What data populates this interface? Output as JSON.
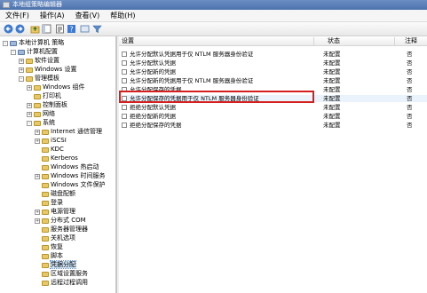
{
  "window": {
    "title": "本地组策略编辑器"
  },
  "menu": [
    "文件(F)",
    "操作(A)",
    "查看(V)",
    "帮助(H)"
  ],
  "toolbar": [
    "back-arrow-icon",
    "forward-arrow-icon",
    "up-folder-icon",
    "show-hide-tree-icon",
    "properties-icon",
    "help-icon",
    "view-icon",
    "filter-icon"
  ],
  "tree": [
    {
      "label": "本地计算机 策略",
      "level": 0,
      "expand": "-",
      "icon": "comp"
    },
    {
      "label": "计算机配置",
      "level": 1,
      "expand": "-",
      "icon": "comp"
    },
    {
      "label": "软件设置",
      "level": 2,
      "expand": "+",
      "icon": "folder"
    },
    {
      "label": "Windows 设置",
      "level": 2,
      "expand": "+",
      "icon": "folder"
    },
    {
      "label": "管理模板",
      "level": 2,
      "expand": "-",
      "icon": "folder"
    },
    {
      "label": "Windows 组件",
      "level": 3,
      "expand": "+",
      "icon": "folder"
    },
    {
      "label": "打印机",
      "level": 3,
      "expand": "",
      "icon": "folder"
    },
    {
      "label": "控制面板",
      "level": 3,
      "expand": "+",
      "icon": "folder"
    },
    {
      "label": "网络",
      "level": 3,
      "expand": "+",
      "icon": "folder"
    },
    {
      "label": "系统",
      "level": 3,
      "expand": "-",
      "icon": "folder"
    },
    {
      "label": "Internet 通信管理",
      "level": 4,
      "expand": "+",
      "icon": "folder"
    },
    {
      "label": "iSCSI",
      "level": 4,
      "expand": "+",
      "icon": "folder"
    },
    {
      "label": "KDC",
      "level": 4,
      "expand": "",
      "icon": "folder"
    },
    {
      "label": "Kerberos",
      "level": 4,
      "expand": "",
      "icon": "folder"
    },
    {
      "label": "Windows 热启动",
      "level": 4,
      "expand": "",
      "icon": "folder"
    },
    {
      "label": "Windows 时间服务",
      "level": 4,
      "expand": "+",
      "icon": "folder"
    },
    {
      "label": "Windows 文件保护",
      "level": 4,
      "expand": "",
      "icon": "folder"
    },
    {
      "label": "磁盘配额",
      "level": 4,
      "expand": "",
      "icon": "folder"
    },
    {
      "label": "登录",
      "level": 4,
      "expand": "",
      "icon": "folder"
    },
    {
      "label": "电源管理",
      "level": 4,
      "expand": "+",
      "icon": "folder"
    },
    {
      "label": "分布式 COM",
      "level": 4,
      "expand": "+",
      "icon": "folder"
    },
    {
      "label": "服务器管理器",
      "level": 4,
      "expand": "",
      "icon": "folder"
    },
    {
      "label": "关机选项",
      "level": 4,
      "expand": "",
      "icon": "folder"
    },
    {
      "label": "恢复",
      "level": 4,
      "expand": "",
      "icon": "folder"
    },
    {
      "label": "脚本",
      "level": 4,
      "expand": "",
      "icon": "folder"
    },
    {
      "label": "凭据分配",
      "level": 4,
      "expand": "",
      "icon": "folder",
      "selected": true
    },
    {
      "label": "区域设置服务",
      "level": 4,
      "expand": "",
      "icon": "folder"
    },
    {
      "label": "远程过程调用",
      "level": 4,
      "expand": "",
      "icon": "folder"
    }
  ],
  "list": {
    "headers": {
      "name": "设置",
      "state": "状态",
      "note": "注释"
    },
    "rows": [
      {
        "name": "允许分配默认凭据用于仅 NTLM 服务器身份验证",
        "state": "未配置",
        "note": "否"
      },
      {
        "name": "允许分配默认凭据",
        "state": "未配置",
        "note": "否"
      },
      {
        "name": "允许分配新的凭据",
        "state": "未配置",
        "note": "否"
      },
      {
        "name": "允许分配新的凭据用于仅 NTLM 服务器身份验证",
        "state": "未配置",
        "note": "否"
      },
      {
        "name": "允许分配保存的凭据",
        "state": "未配置",
        "note": "否"
      },
      {
        "name": "允许分配保存的凭据用于仅 NTLM 服务器身份验证",
        "state": "未配置",
        "note": "否",
        "highlight": true
      },
      {
        "name": "拒绝分配默认凭据",
        "state": "未配置",
        "note": "否"
      },
      {
        "name": "拒绝分配新的凭据",
        "state": "未配置",
        "note": "否"
      },
      {
        "name": "拒绝分配保存的凭据",
        "state": "未配置",
        "note": "否"
      }
    ]
  },
  "colors": {
    "highlight_box": "#d51f1f",
    "title_bar": "#4d71ab"
  }
}
